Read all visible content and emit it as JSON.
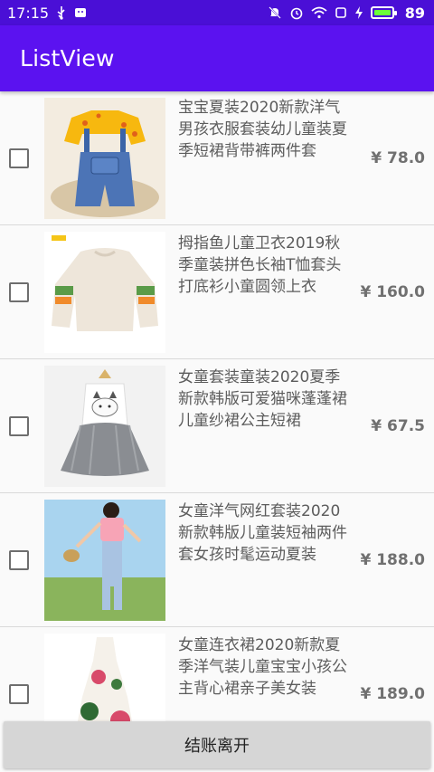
{
  "status_bar": {
    "time": "17:15",
    "battery_level": "89",
    "icons": [
      "usb-icon",
      "notification-icon",
      "mute-icon",
      "alarm-icon",
      "wifi-icon",
      "screen-icon",
      "charging-icon",
      "battery-icon"
    ]
  },
  "app_bar": {
    "title": "ListView"
  },
  "items": [
    {
      "name": "宝宝夏装2020新款洋气男孩衣服套装幼儿童装夏季短裙背带裤两件套",
      "price": "¥ 78.0",
      "checked": false,
      "image": "overalls-tshirt-image"
    },
    {
      "name": "拇指鱼儿童卫衣2019秋季童装拼色长袖T恤套头打底衫小童圆领上衣",
      "price": "¥ 160.0",
      "checked": false,
      "image": "sweatshirt-image"
    },
    {
      "name": "女童套装童装2020夏季新款韩版可爱猫咪蓬蓬裙儿童纱裙公主短裙",
      "price": "¥ 67.5",
      "checked": false,
      "image": "cat-tutu-dress-image"
    },
    {
      "name": "女童洋气网红套装2020新款韩版儿童装短袖两件套女孩时髦运动夏装",
      "price": "¥ 188.0",
      "checked": false,
      "image": "girl-outfit-image"
    },
    {
      "name": "女童连衣裙2020新款夏季洋气装儿童宝宝小孩公主背心裙亲子美女装",
      "price": "¥ 189.0",
      "checked": false,
      "image": "floral-dress-image"
    }
  ],
  "footer": {
    "checkout_label": "结账离开"
  },
  "colors": {
    "status_bar": "#4a0fd6",
    "app_bar": "#5b12f0",
    "battery_fill": "#6bff37"
  }
}
